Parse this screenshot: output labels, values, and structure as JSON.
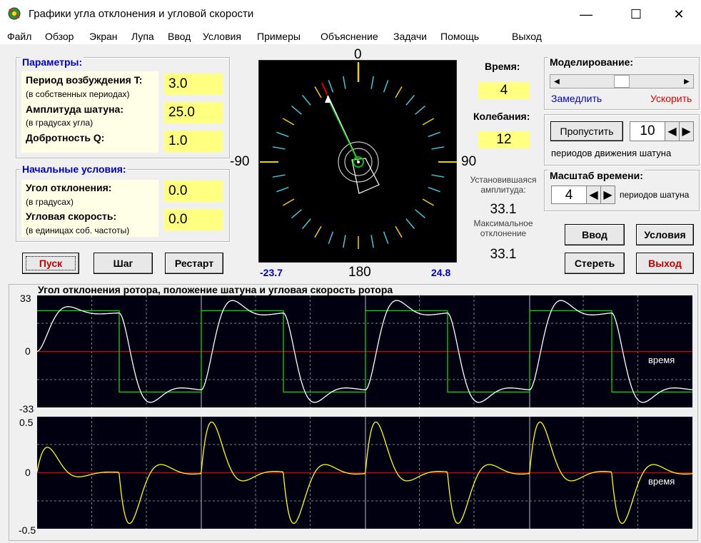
{
  "window": {
    "title": "Графики угла отклонения и угловой скорости",
    "minimize": "—",
    "maximize": "☐",
    "close": "✕"
  },
  "menu": [
    "Файл",
    "Обзор",
    "Экран",
    "Лупа",
    "Ввод",
    "Условия",
    "Примеры",
    "Объяснение",
    "Задачи",
    "Помощь",
    "Выход"
  ],
  "params": {
    "title": "Параметры:",
    "period_label": "Период возбуждения T:",
    "period_sub": "(в собственных периодах)",
    "period_value": "3.0",
    "amp_label": "Амплитуда шатуна:",
    "amp_sub": "(в градусах угла)",
    "amp_value": "25.0",
    "q_label": "Добротность Q:",
    "q_value": "1.0"
  },
  "initial": {
    "title": "Начальные условия:",
    "angle_label": "Угол отклонения:",
    "angle_sub": "(в градусах)",
    "angle_value": "0.0",
    "vel_label": "Угловая скорость:",
    "vel_sub": "(в единицах соб. частоты)",
    "vel_value": "0.0"
  },
  "buttons": {
    "start": "Пуск",
    "step": "Шаг",
    "restart": "Рестарт",
    "input": "Ввод",
    "conditions": "Условия",
    "erase": "Стереть",
    "exit": "Выход",
    "skip": "Пропустить"
  },
  "dial": {
    "top": "0",
    "left": "-90",
    "right": "90",
    "bottom": "180",
    "min": "-23.7",
    "max": "24.8"
  },
  "status": {
    "time_label": "Время:",
    "time_value": "4",
    "osc_label": "Колебания:",
    "osc_value": "12",
    "steady_label": "Установившаяся амплитуда:",
    "steady_value": "33.1",
    "max_label": "Максимальное отклонение",
    "max_value": "33.1"
  },
  "sim": {
    "title": "Моделирование:",
    "slower": "Замедлить",
    "faster": "Ускорить",
    "speed": 0.5
  },
  "skip": {
    "value": "10",
    "caption": "периодов движения шатуна"
  },
  "scale": {
    "title": "Масштаб времени:",
    "value": "4",
    "caption": "периодов шатуна"
  },
  "graphs": {
    "title": "Угол отклонения ротора, положение шатуна и угловая скорость ротора",
    "top_max": "33",
    "top_zero": "0",
    "top_min": "-33",
    "top_time": "время",
    "bot_max": "0.5",
    "bot_zero": "0",
    "bot_min": "-0.5",
    "bot_time": "время"
  },
  "colors": {
    "accent": "#0000c0",
    "exit": "#c00000",
    "faster": "#e00000",
    "plot_bg": "#000010",
    "angle_curve": "#ffffff",
    "rod_curve": "#00e000",
    "velocity_curve": "#ffff00",
    "zero_line": "#e00000"
  }
}
